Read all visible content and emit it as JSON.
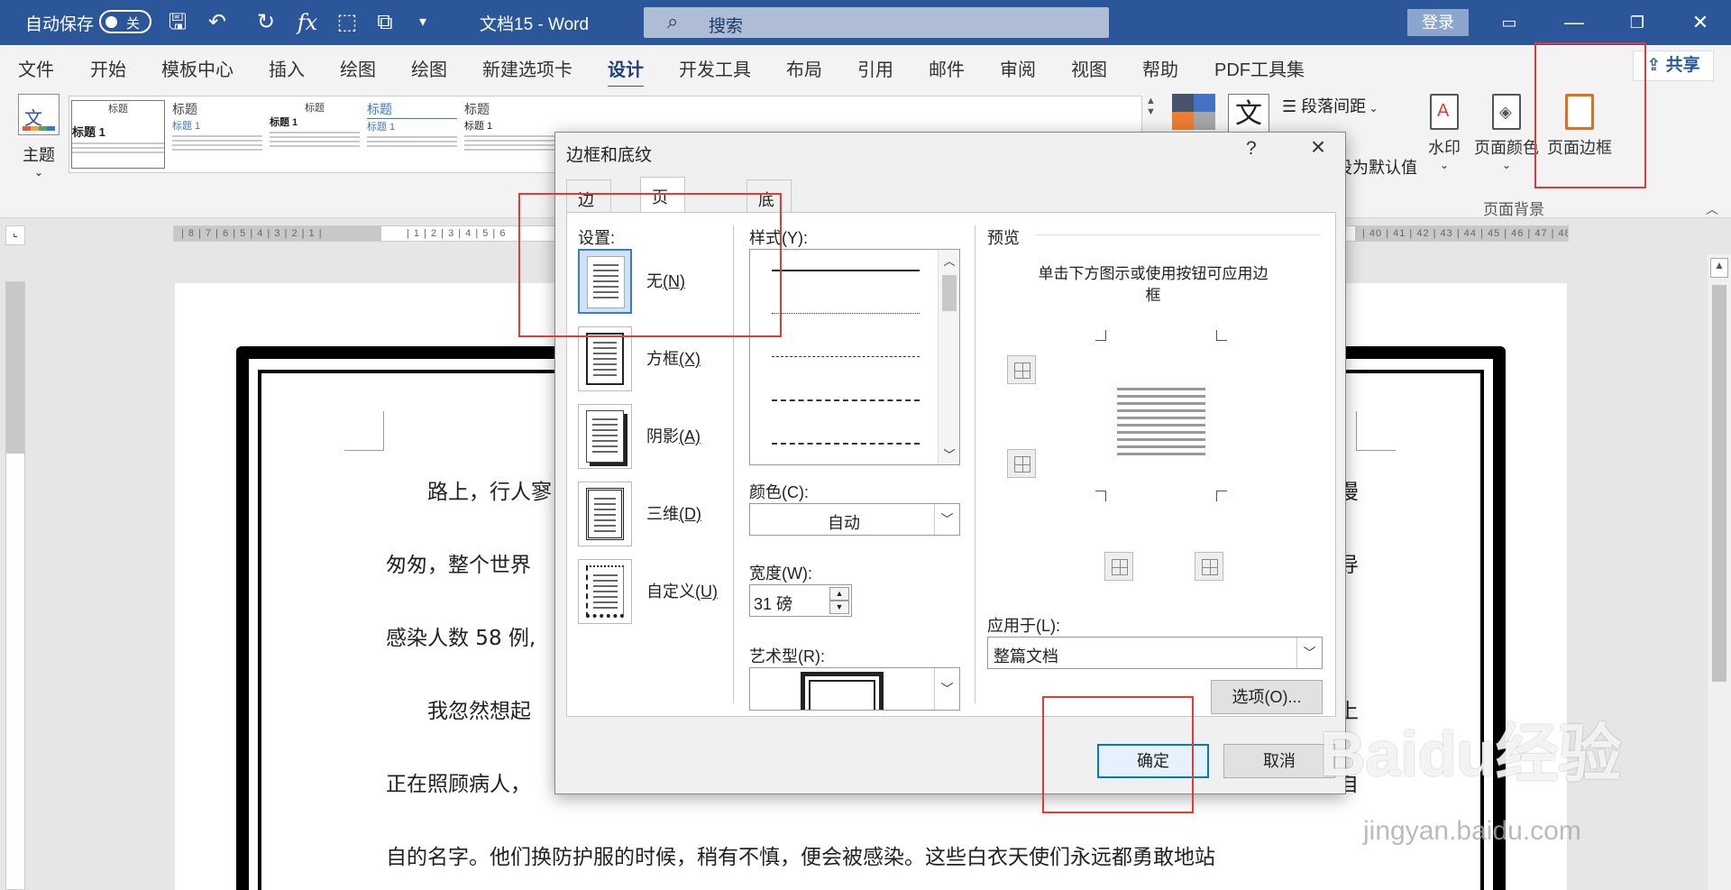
{
  "titlebar": {
    "autosave": "自动保存",
    "toggle": "关",
    "doc_title": "文档15  -  Word",
    "search_placeholder": "搜索",
    "login": "登录"
  },
  "menu": {
    "tabs": [
      "文件",
      "开始",
      "模板中心",
      "插入",
      "绘图",
      "绘图",
      "新建选项卡",
      "设计",
      "开发工具",
      "布局",
      "引用",
      "邮件",
      "审阅",
      "视图",
      "帮助",
      "PDF工具集"
    ],
    "active": "设计",
    "share": "共享"
  },
  "ribbon": {
    "theme_label": "主题",
    "gallery": [
      {
        "title": "标题",
        "sub": "标题 1"
      },
      {
        "title": "标题",
        "sub": "标题 1"
      },
      {
        "title": "标题",
        "sub": "标题 1"
      },
      {
        "title": "标题",
        "sub": "标题 1"
      },
      {
        "title": "标题",
        "sub": "标题 1"
      }
    ],
    "paragraph_spacing": "段落间距",
    "set_default": "设为默认值",
    "watermark": "水印",
    "page_color": "页面颜色",
    "page_borders": "页面边框",
    "group_label": "页面背景"
  },
  "document": {
    "lines": [
      "路上，行人寥",
      "匆匆，整个世界",
      "感染人数 58 例,",
      "我忽然想起",
      "正在照顾病人，",
      "自的名字。他们换防护服的时候，稍有不慎，便会被感染。这些白衣天使们永远都勇敢地站"
    ],
    "right_fragments": [
      "漫",
      "导",
      "上",
      "自"
    ]
  },
  "dialog": {
    "title": "边框和底纹",
    "help": "?",
    "tabs": [
      {
        "label": "边框",
        "key": "(B)"
      },
      {
        "label": "页面边框",
        "key": "(P)"
      },
      {
        "label": "底纹",
        "key": "(S)"
      }
    ],
    "setting_label": "设置:",
    "settings": [
      {
        "label": "无",
        "key": "(N)"
      },
      {
        "label": "方框",
        "key": "(X)"
      },
      {
        "label": "阴影",
        "key": "(A)"
      },
      {
        "label": "三维",
        "key": "(D)"
      },
      {
        "label": "自定义",
        "key": "(U)"
      }
    ],
    "style_label": "样式(Y):",
    "color_label": "颜色(C):",
    "color_value": "自动",
    "width_label": "宽度(W):",
    "width_value": "31 磅",
    "art_label": "艺术型(R):",
    "preview_label": "预览",
    "preview_hint": "单击下方图示或使用按钮可应用边框",
    "apply_label": "应用于(L):",
    "apply_value": "整篇文档",
    "options_button": "选项(O)...",
    "ok_button": "确定",
    "cancel_button": "取消"
  },
  "watermark": {
    "brand": "Baidu经验",
    "url": "jingyan.baidu.com"
  }
}
